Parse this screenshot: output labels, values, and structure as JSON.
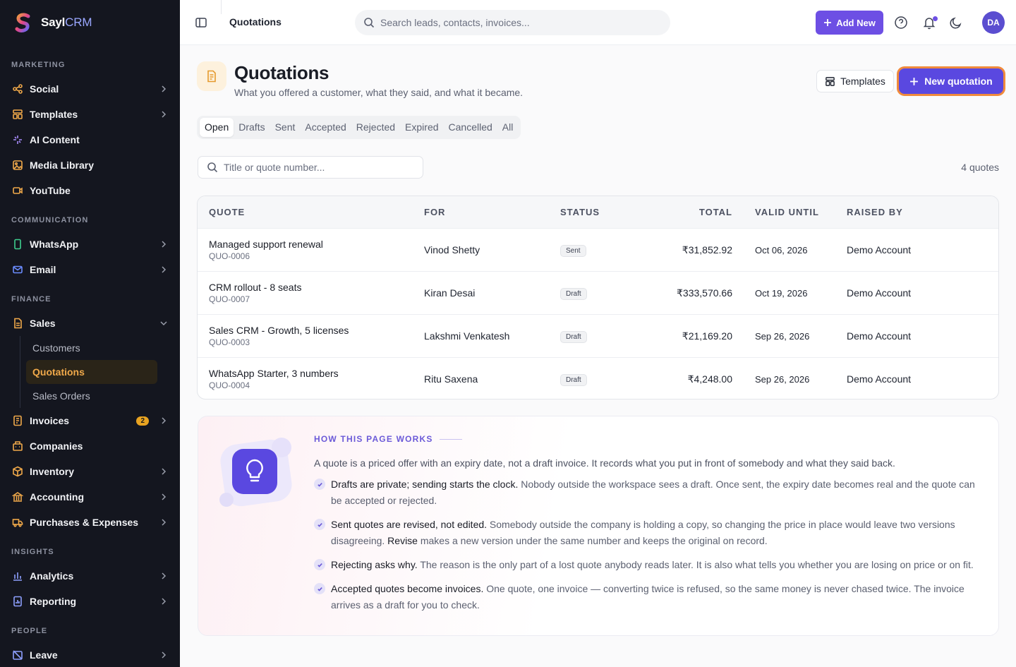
{
  "brand": {
    "name_main": "Sayl",
    "name_accent": "CRM"
  },
  "sidebar": {
    "sections": {
      "marketing": "MARKETING",
      "communication": "COMMUNICATION",
      "finance": "FINANCE",
      "insights": "INSIGHTS",
      "people": "PEOPLE"
    },
    "items": {
      "social": "Social",
      "templates": "Templates",
      "ai_content": "AI Content",
      "media_library": "Media Library",
      "youtube": "YouTube",
      "whatsapp": "WhatsApp",
      "email": "Email",
      "sales": "Sales",
      "invoices": "Invoices",
      "invoices_badge": "2",
      "companies": "Companies",
      "inventory": "Inventory",
      "accounting": "Accounting",
      "purchases": "Purchases & Expenses",
      "analytics": "Analytics",
      "reporting": "Reporting",
      "leave": "Leave"
    },
    "sales_sub": [
      "Customers",
      "Quotations",
      "Sales Orders"
    ]
  },
  "topbar": {
    "breadcrumb": "Quotations",
    "search_placeholder": "Search leads, contacts, invoices...",
    "add_new": "Add New",
    "avatar_initials": "DA"
  },
  "page": {
    "title": "Quotations",
    "subtitle": "What you offered a customer, what they said, and what it became.",
    "templates_btn": "Templates",
    "new_btn": "New quotation"
  },
  "tabs": [
    "Open",
    "Drafts",
    "Sent",
    "Accepted",
    "Rejected",
    "Expired",
    "Cancelled",
    "All"
  ],
  "filter": {
    "placeholder": "Title or quote number...",
    "count": "4 quotes"
  },
  "table": {
    "headers": {
      "quote": "QUOTE",
      "for": "FOR",
      "status": "STATUS",
      "total": "TOTAL",
      "valid": "VALID UNTIL",
      "raised": "RAISED BY"
    },
    "rows": [
      {
        "title": "Managed support renewal",
        "number": "QUO-0006",
        "for": "Vinod Shetty",
        "status": "Sent",
        "total": "₹31,852.92",
        "valid": "Oct 06, 2026",
        "raised": "Demo Account"
      },
      {
        "title": "CRM rollout - 8 seats",
        "number": "QUO-0007",
        "for": "Kiran Desai",
        "status": "Draft",
        "total": "₹333,570.66",
        "valid": "Oct 19, 2026",
        "raised": "Demo Account"
      },
      {
        "title": "Sales CRM - Growth, 5 licenses",
        "number": "QUO-0003",
        "for": "Lakshmi Venkatesh",
        "status": "Draft",
        "total": "₹21,169.20",
        "valid": "Sep 26, 2026",
        "raised": "Demo Account"
      },
      {
        "title": "WhatsApp Starter, 3 numbers",
        "number": "QUO-0004",
        "for": "Ritu Saxena",
        "status": "Draft",
        "total": "₹4,248.00",
        "valid": "Sep 26, 2026",
        "raised": "Demo Account"
      }
    ]
  },
  "info": {
    "heading": "HOW THIS PAGE WORKS",
    "intro": "A quote is a priced offer with an expiry date, not a draft invoice. It records what you put in front of somebody and what they said back.",
    "points": [
      {
        "strong": "Drafts are private; sending starts the clock.",
        "text": " Nobody outside the workspace sees a draft. Once sent, the expiry date becomes real and the quote can be accepted or rejected."
      },
      {
        "strong": "Sent quotes are revised, not edited.",
        "text": " Somebody outside the company is holding a copy, so changing the price in place would leave two versions disagreeing. ",
        "strong2": "Revise",
        "text2": " makes a new version under the same number and keeps the original on record."
      },
      {
        "strong": "Rejecting asks why.",
        "text": " The reason is the only part of a lost quote anybody reads later. It is also what tells you whether you are losing on price or on fit."
      },
      {
        "strong": "Accepted quotes become invoices.",
        "text": " One quote, one invoice — converting twice is refused, so the same money is never chased twice. The invoice arrives as a draft for you to check."
      }
    ]
  },
  "colors": {
    "accent": "#5a48e0",
    "highlight": "#f08a3c",
    "sidebar_bg": "#14161f",
    "active_sub": "#f0a94a"
  }
}
